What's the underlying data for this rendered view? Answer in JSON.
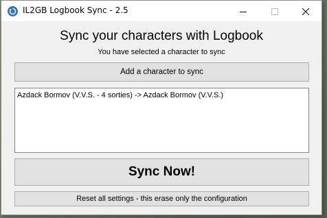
{
  "window": {
    "title": "IL2GB Logbook Sync - 2.5"
  },
  "main": {
    "heading": "Sync your characters with Logbook",
    "subheading": "You have selected a character to sync",
    "add_button_label": "Add a character to sync",
    "characters": [
      "Azdack Bormov (V.V.S. - 4 sorties) -> Azdack Bormov (V.V.S.)"
    ],
    "sync_button_label": "Sync Now!",
    "reset_button_label": "Reset all settings - this erase only the configuration"
  },
  "icons": {
    "app": "sync-icon",
    "minimize": "minimize-icon",
    "maximize": "maximize-icon",
    "close": "close-icon"
  },
  "colors": {
    "app_icon": "#2d73c8",
    "button_bg": "#e1e1e1",
    "window_bg": "#f0f0f0"
  }
}
